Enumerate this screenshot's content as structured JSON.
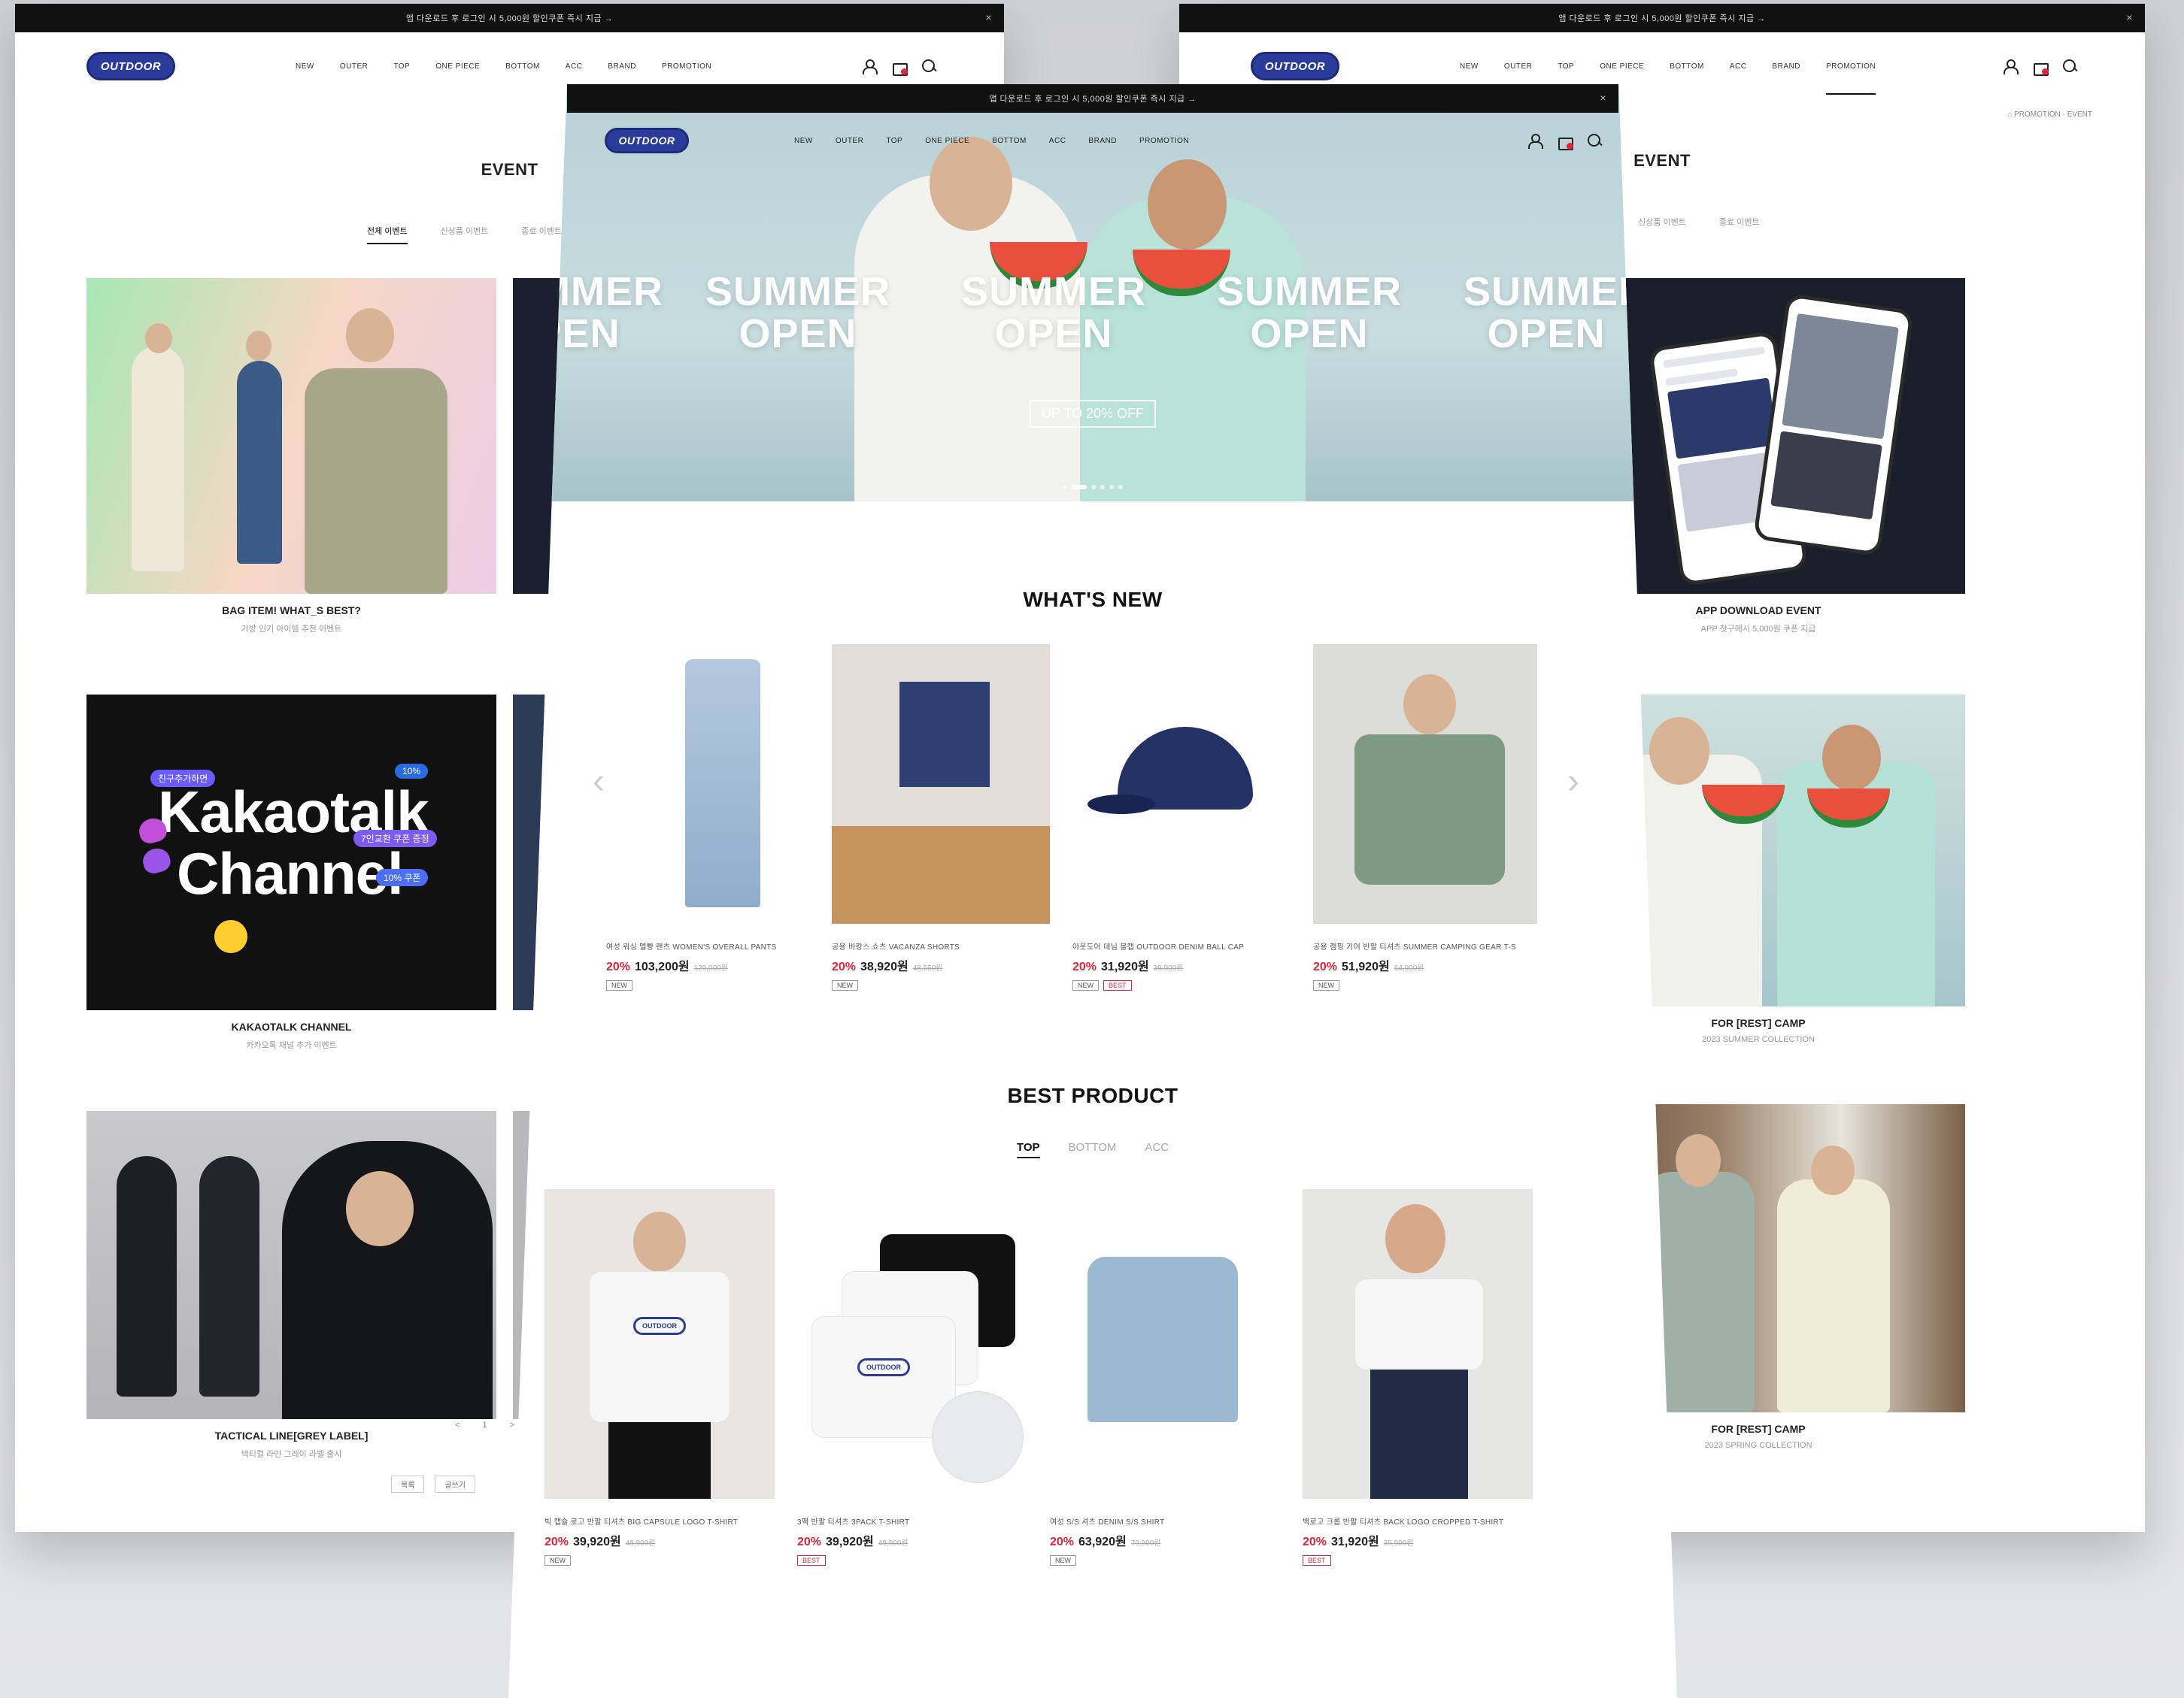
{
  "promo_text": "앱 다운로드 후 로그인 시 5,000원 할인쿠폰 즉시 지급 →",
  "promo_close": "×",
  "logo_text": "OUTDOOR",
  "nav": [
    "NEW",
    "OUTER",
    "TOP",
    "ONE PIECE",
    "BOTTOM",
    "ACC",
    "BRAND",
    "PROMOTION"
  ],
  "breadcrumb": "⌂  PROMOTION  ·  EVENT",
  "event": {
    "title": "EVENT",
    "tabs": [
      "전체 이벤트",
      "신상품 이벤트",
      "종료 이벤트"
    ],
    "cards_left": [
      {
        "title": "BAG ITEM! WHAT_S BEST?",
        "sub": "가방 인기 아이템 추천 이벤트"
      },
      {
        "title": "KAKAOTALK CHANNEL",
        "sub": "카카오톡 채널 추가 이벤트"
      },
      {
        "title": "TACTICAL LINE[GREY LABEL]",
        "sub": "택티컬 라인 그레이 라벨 출시"
      }
    ],
    "cards_right": [
      {
        "title": "APP DOWNLOAD EVENT",
        "sub": "APP 첫구매시 5,000원 쿠폰 지급"
      },
      {
        "title": "FOR [REST] CAMP",
        "sub": "2023 SUMMER COLLECTION"
      },
      {
        "title": "FOR [REST] CAMP",
        "sub": "2023 SPRING COLLECTION"
      }
    ],
    "kakao_lines": [
      "Kakaotalk",
      "Channel"
    ],
    "kakao_pill": "친구추가하면",
    "kakao_badges": [
      "10%",
      "7인교환 쿠폰 증정",
      "10% 쿠폰"
    ],
    "pagination": [
      "<",
      "1",
      ">"
    ],
    "page_buttons": [
      "목록",
      "글쓰기"
    ]
  },
  "hero": {
    "words": [
      "SUMMER OPEN",
      "SUMMER OPEN",
      "SUMMER OPEN",
      "SUMMER OPEN",
      "SUMMER OPEN"
    ],
    "cta": "UP TO 20% OFF"
  },
  "whats_new": {
    "title": "WHAT'S NEW",
    "products": [
      {
        "name": "여성 워싱 멜빵 팬츠 WOMEN'S OVERALL PANTS",
        "discount": "20%",
        "price": "103,200원",
        "old": "129,000원",
        "tags": [
          "NEW"
        ]
      },
      {
        "name": "공용 바캉스 쇼츠 VACANZA SHORTS",
        "discount": "20%",
        "price": "38,920원",
        "old": "48,650원",
        "tags": [
          "NEW"
        ]
      },
      {
        "name": "아웃도어 데님 볼캡 OUTDOOR DENIM BALL CAP",
        "discount": "20%",
        "price": "31,920원",
        "old": "39,900원",
        "tags": [
          "NEW",
          "BEST"
        ]
      },
      {
        "name": "공용 캠핑 기어 반팔 티셔츠 SUMMER CAMPING GEAR T-S",
        "discount": "20%",
        "price": "51,920원",
        "old": "64,900원",
        "tags": [
          "NEW"
        ]
      }
    ]
  },
  "best_product": {
    "title": "BEST PRODUCT",
    "tabs": [
      "TOP",
      "BOTTOM",
      "ACC"
    ],
    "products": [
      {
        "name": "빅 캡슐 로고 반팔 티셔츠 BIG CAPSULE LOGO T-SHIRT",
        "discount": "20%",
        "price": "39,920원",
        "old": "49,900원",
        "tags": [
          "NEW"
        ]
      },
      {
        "name": "3팩 반팔 티셔츠 3PACK T-SHIRT",
        "discount": "20%",
        "price": "39,920원",
        "old": "49,900원",
        "tags": [
          "BEST"
        ]
      },
      {
        "name": "여성 S/S 셔츠 DENIM S/S SHIRT",
        "discount": "20%",
        "price": "63,920원",
        "old": "79,900원",
        "tags": [
          "NEW"
        ]
      },
      {
        "name": "백로고 크롭 반팔 티셔츠 BACK LOGO CROPPED T-SHIRT",
        "discount": "20%",
        "price": "31,920원",
        "old": "39,900원",
        "tags": [
          "BEST"
        ]
      }
    ]
  },
  "colors": {
    "brand_navy": "#2a3b9c",
    "sale_red": "#e0243a",
    "promo_bar": "#111111"
  },
  "icons": [
    "user-icon",
    "cart-icon",
    "search-icon",
    "close-icon",
    "chevron-left-icon",
    "chevron-right-icon"
  ]
}
